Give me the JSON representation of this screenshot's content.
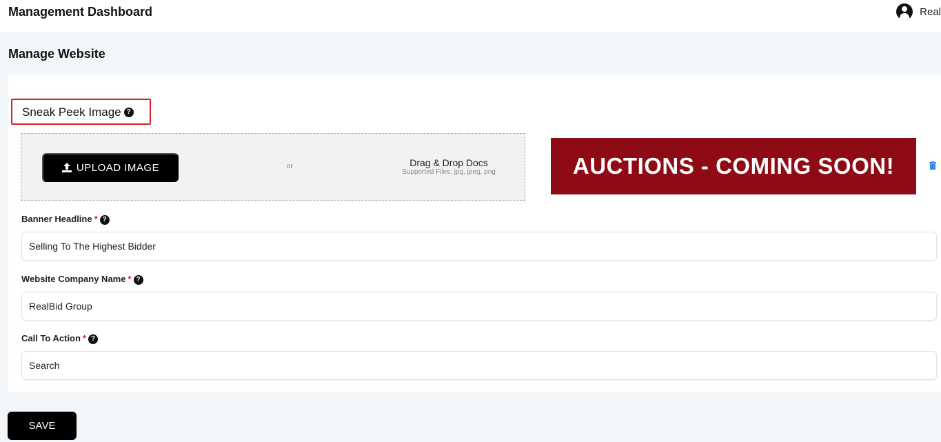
{
  "header": {
    "title": "Management Dashboard",
    "user_name": "Real"
  },
  "page": {
    "title": "Manage Website"
  },
  "sneak_peek": {
    "label": "Sneak Peek Image",
    "upload_label": "UPLOAD IMAGE",
    "or": "or",
    "drag_title": "Drag & Drop Docs",
    "drag_sub": "Supported Files: jpg, jpeg, png",
    "banner_text": "AUCTIONS - COMING SOON!",
    "banner_color": "#8e0a14"
  },
  "fields": [
    {
      "label": "Banner Headline",
      "required": "*",
      "value": "Selling To The Highest Bidder"
    },
    {
      "label": "Website Company Name",
      "required": "*",
      "value": "RealBid Group"
    },
    {
      "label": "Call To Action",
      "required": "*",
      "value": "Search"
    }
  ],
  "help": "?",
  "save_label": "SAVE"
}
